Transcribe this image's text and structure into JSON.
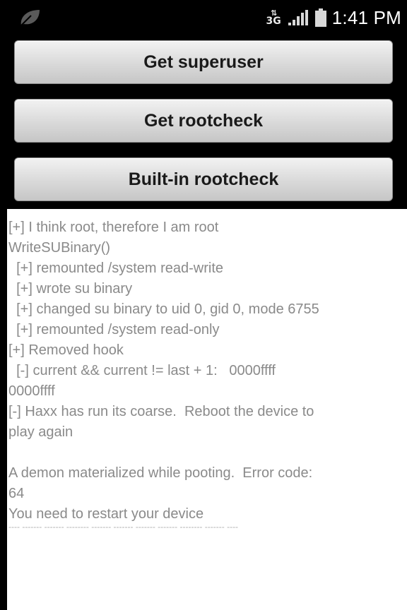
{
  "status_bar": {
    "network_type": "3G",
    "time": "1:41 PM"
  },
  "buttons": {
    "get_superuser": "Get superuser",
    "get_rootcheck": "Get rootcheck",
    "builtin_rootcheck": "Built-in rootcheck"
  },
  "log": {
    "lines": [
      "[+] I think root, therefore I am root",
      "WriteSUBinary()",
      "  [+] remounted /system read-write",
      "  [+] wrote su binary",
      "  [+] changed su binary to uid 0, gid 0, mode 6755",
      "  [+] remounted /system read-only",
      "[+] Removed hook",
      "  [-] current && current != last + 1:   0000ffff",
      "0000ffff",
      "[-] Haxx has run its coarse.  Reboot the device to",
      "play again",
      "",
      "A demon materialized while pooting.  Error code:",
      "64",
      "You need to restart your device"
    ],
    "separator": "---- ------- ------- -------- ------- ------- ------- ------- -------- ------- ----"
  },
  "colors": {
    "background": "#000000",
    "button_text": "#1a1a1a",
    "log_text": "#8a8a8a",
    "log_background": "#ffffff"
  }
}
